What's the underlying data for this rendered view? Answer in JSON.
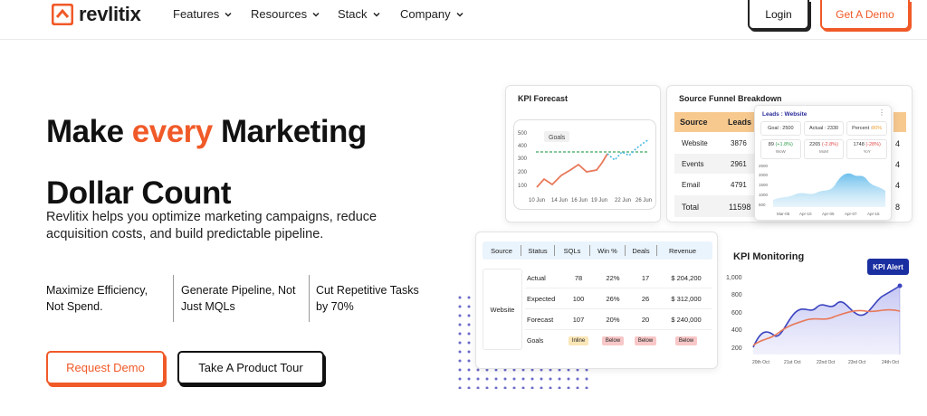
{
  "brand": {
    "name": "revlitix",
    "accent": "#f05a28"
  },
  "nav": {
    "items": [
      {
        "label": "Features"
      },
      {
        "label": "Resources"
      },
      {
        "label": "Stack"
      },
      {
        "label": "Company"
      }
    ],
    "login": "Login",
    "demo": "Get A Demo"
  },
  "hero": {
    "title_part1": "Make ",
    "title_accent": "every",
    "title_part2": " Marketing",
    "title_line2": "Dollar Count",
    "subtitle": "Revlitix helps you optimize marketing campaigns, reduce acquisition costs, and build predictable pipeline.",
    "features": [
      {
        "line1": "Maximize Efficiency,",
        "line2": "Not Spend."
      },
      {
        "line1": "Generate Pipeline, Not",
        "line2": "Just MQLs"
      },
      {
        "line1": "Cut Repetitive Tasks",
        "line2": "by 70%"
      }
    ],
    "cta_primary": "Request Demo",
    "cta_secondary": "Take A Product Tour"
  },
  "kpi_forecast": {
    "title": "KPI Forecast",
    "goal_label": "Goals",
    "y_ticks": [
      "500",
      "400",
      "300",
      "200",
      "100"
    ],
    "x_ticks": [
      "10 Jun",
      "14 Jun",
      "16 Jun",
      "19 Jun",
      "22 Jun",
      "26 Jun"
    ]
  },
  "funnel": {
    "title": "Source Funnel Breakdown",
    "col_source": "Source",
    "col_leads": "Leads",
    "rows": [
      {
        "source": "Website",
        "leads": "3876",
        "extra": "4"
      },
      {
        "source": "Events",
        "leads": "2961",
        "extra": "4"
      },
      {
        "source": "Email",
        "leads": "4791",
        "extra": "4"
      },
      {
        "source": "Total",
        "leads": "11598",
        "extra": "8"
      }
    ],
    "popup": {
      "title": "Leads : Website",
      "goal": "Goal : 2500",
      "actual": "Actual : 2330",
      "percent_label": "Percent : ",
      "percent_value": "80%",
      "stats": [
        {
          "value": "89",
          "delta": "(+1.8%)",
          "label": "WoW",
          "delta_color": "#2e9e4f"
        },
        {
          "value": "2265",
          "delta": "(-2.8%)",
          "label": "MoM",
          "delta_color": "#e04848"
        },
        {
          "value": "1748",
          "delta": "(-28%)",
          "label": "YoY",
          "delta_color": "#e04848"
        }
      ],
      "y_ticks": [
        "2500",
        "2000",
        "1500",
        "1000",
        "500"
      ],
      "x_ticks": [
        "Mar-05",
        "Apr-10",
        "Apr-05",
        "Apr-07",
        "Apr-15"
      ]
    }
  },
  "source_table": {
    "headers": [
      "Source",
      "Status",
      "SQLs",
      "Win %",
      "Deals",
      "Revenue"
    ],
    "source": "Website",
    "rows": [
      {
        "status": "Actual",
        "sqls": "78",
        "win": "22%",
        "deals": "17",
        "revenue": "$ 204,200"
      },
      {
        "status": "Expected",
        "sqls": "100",
        "win": "26%",
        "deals": "26",
        "revenue": "$ 312,000"
      },
      {
        "status": "Forecast",
        "sqls": "107",
        "win": "20%",
        "deals": "20",
        "revenue": "$ 240,000"
      }
    ],
    "goals_label": "Goals",
    "goals": [
      "Inline",
      "Below",
      "Below",
      "Below"
    ]
  },
  "kpi_monitoring": {
    "title": "KPI Monitoring",
    "alert": "KPI Alert",
    "y_ticks": [
      "1,000",
      "800",
      "600",
      "400",
      "200"
    ],
    "x_ticks": [
      "20th Oct",
      "21st Oct",
      "22nd Oct",
      "23rd Oct",
      "24th Oct"
    ]
  }
}
